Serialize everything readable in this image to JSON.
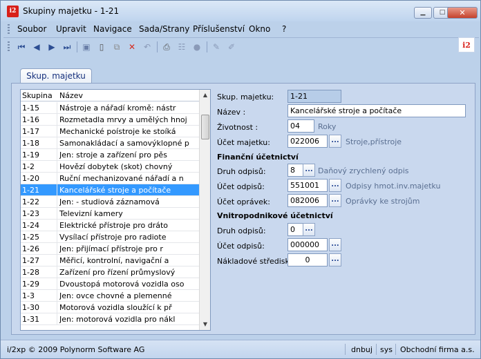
{
  "window": {
    "title": "Skupiny majetku - 1-21",
    "app_icon_text": "i2",
    "minimize_glyph": "▁",
    "maximize_glyph": "□",
    "close_glyph": "✕"
  },
  "menu": [
    "Soubor",
    "Upravit",
    "Navigace",
    "Sada/Strany",
    "Příslušenství",
    "Okno",
    "?"
  ],
  "toolbar": {
    "icons": [
      "first-record-icon",
      "previous-record-icon",
      "next-record-icon",
      "last-record-icon",
      "save-icon",
      "new-record-icon",
      "copy-icon",
      "delete-icon",
      "undo-icon",
      "print-icon",
      "tree-icon",
      "search-icon",
      "edit-icon",
      "pen-icon"
    ],
    "logo_text": "i2"
  },
  "tab": {
    "label": "Skup. majetku"
  },
  "grid": {
    "columns": [
      "Skupina",
      "Název"
    ],
    "rows": [
      {
        "code": "1-15",
        "name": "Nástroje a nářadí kromě: nástr"
      },
      {
        "code": "1-16",
        "name": "Rozmetadla mrvy a umělých hnoj"
      },
      {
        "code": "1-17",
        "name": "Mechanické poístroje ke stoíká"
      },
      {
        "code": "1-18",
        "name": "Samonakládací a samovýklopné p"
      },
      {
        "code": "1-19",
        "name": "Jen: stroje a zařízení pro pěs"
      },
      {
        "code": "1-2",
        "name": "Hovězí dobytek (skot) chovný"
      },
      {
        "code": "1-20",
        "name": "Ruční mechanizované nářadí a n"
      },
      {
        "code": "1-21",
        "name": "Kancelářské stroje a počítače"
      },
      {
        "code": "1-22",
        "name": "Jen:    - studiová záznamová"
      },
      {
        "code": "1-23",
        "name": "Televizní kamery"
      },
      {
        "code": "1-24",
        "name": "Elektrické přístroje pro dráto"
      },
      {
        "code": "1-25",
        "name": "Vysílací přístroje pro radiote"
      },
      {
        "code": "1-26",
        "name": "Jen: přijímací přístroje pro r"
      },
      {
        "code": "1-27",
        "name": "Měřicí, kontrolní, navigační a"
      },
      {
        "code": "1-28",
        "name": "Zařízení pro řízení průmyslový"
      },
      {
        "code": "1-29",
        "name": "Dvoustopá motorová vozidla oso"
      },
      {
        "code": "1-3",
        "name": "Jen: ovce chovné a plemenné"
      },
      {
        "code": "1-30",
        "name": "Motorová vozidla sloužící k př"
      },
      {
        "code": "1-31",
        "name": "Jen: motorová vozidla pro nákl"
      }
    ],
    "selected_index": 7
  },
  "form": {
    "skup_label": "Skup. majetku:",
    "skup_value": "1-21",
    "nazev_label": "Název    :",
    "nazev_value": "Kancelářské stroje a počítače",
    "zivotnost_label": "Životnost    :",
    "zivotnost_value": "04",
    "zivotnost_unit": "Roky",
    "ucet_majetku_label": "Účet majetku:",
    "ucet_majetku_value": "022006",
    "ucet_majetku_desc": "Stroje,přístroje",
    "fin_section": "Finanční účetnictví",
    "fin_druh_label": "Druh odpisů:",
    "fin_druh_value": "8",
    "fin_druh_desc": "Daňový zrychlený odpis",
    "fin_ucet_odpisu_label": "Účet odpisů:",
    "fin_ucet_odpisu_value": "551001",
    "fin_ucet_odpisu_desc": "Odpisy hmot.inv.majetku",
    "fin_ucet_opravek_label": "Účet oprávek:",
    "fin_ucet_opravek_value": "082006",
    "fin_ucet_opravek_desc": "Oprávky ke strojům",
    "vni_section": "Vnitropodnikové účetnictví",
    "vni_druh_label": "Druh odpisů:",
    "vni_druh_value": "0",
    "vni_ucet_odpisu_label": "Účet odpisů:",
    "vni_ucet_odpisu_value": "000000",
    "vni_stredisko_label": "Nákladové středisko:",
    "vni_stredisko_value": "0",
    "dots_label": "..."
  },
  "status": {
    "copyright": "i/2xp © 2009 Polynorm Software AG",
    "user": "dnbuj",
    "system": "sys",
    "company": "Obchodní firma a.s."
  }
}
